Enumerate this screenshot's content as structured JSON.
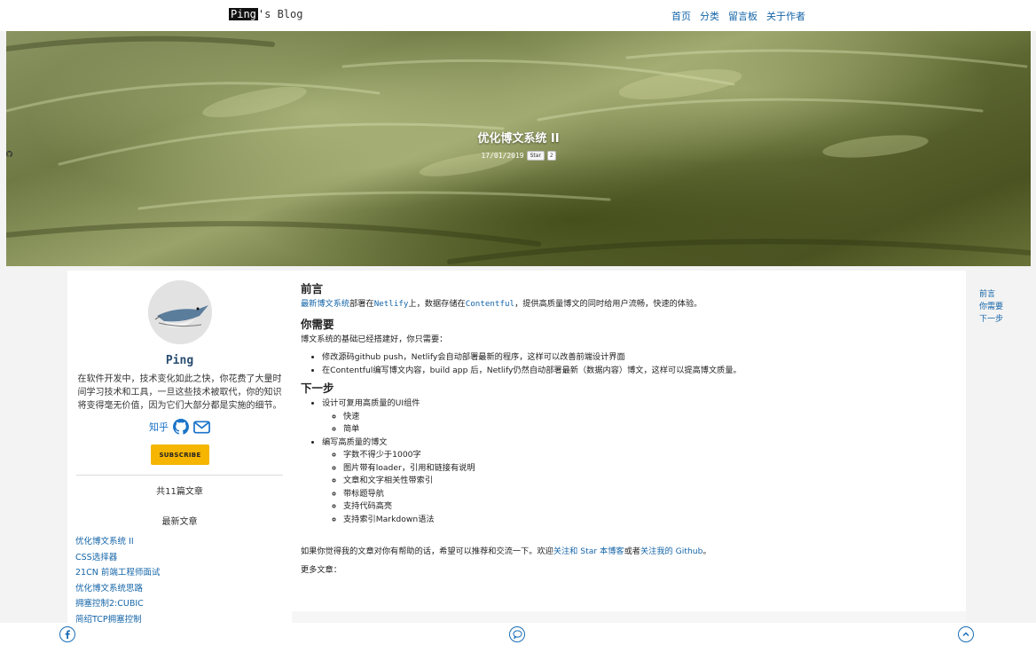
{
  "brand": {
    "highlight": "Ping",
    "rest": "'s Blog"
  },
  "nav": [
    "首页",
    "分类",
    "留言板",
    "关于作者"
  ],
  "hero": {
    "title": "优化博文系统 II",
    "date": "17/01/2019",
    "github_button": "Star",
    "star_count": "2"
  },
  "sidebar": {
    "author": "Ping",
    "bio": "在软件开发中，技术变化如此之快，你花费了大量时间学习技术和工具，一旦这些技术被取代，你的知识将变得毫无价值，因为它们大部分都是实施的细节。",
    "zhihu": "知乎",
    "icons": [
      "github-icon",
      "mail-icon"
    ],
    "subscribe": "SUBSCRIBE",
    "count": "共11篇文章",
    "recent_heading": "最新文章",
    "recent": [
      "优化博文系统 II",
      "CSS选择器",
      "21CN 前端工程师面试",
      "优化博文系统思路",
      "拥塞控制2:CUBIC",
      "简绍TCP拥塞控制"
    ]
  },
  "article": {
    "h_preface": "前言",
    "preface": {
      "link1": "最新博文系统",
      "t1": "部署在",
      "netlify": "Netlify",
      "t2": "上，数据存储在",
      "contentful": "Contentful",
      "t3": "，提供高质量博文的同时给用户流畅，快速的体验。"
    },
    "h_need": "你需要",
    "need_intro": "博文系统的基础已经搭建好，你只需要：",
    "need_items": [
      "修改源码github push，Netlify会自动部署最新的程序，这样可以改善前端设计界面",
      "在Contentful编写博文内容，build app 后，Netlify仍然自动部署最新（数据内容）博文，这样可以提高博文质量。"
    ],
    "h_next": "下一步",
    "next": {
      "item1": "设计可复用高质量的UI组件",
      "item1_sub": [
        "快速",
        "简单"
      ],
      "item2": "编写高质量的博文",
      "item2_sub": [
        "字数不得少于1000字",
        "图片带有loader，引用和链接有说明",
        "文章和文字相关性带索引",
        "带标题导航",
        "支持代码高亮",
        "支持索引Markdown语法"
      ]
    },
    "closing": {
      "t1": "如果你觉得我的文章对你有帮助的话，希望可以推荐和交流一下。欢迎",
      "l1": "关注和 Star 本博客",
      "t2": "或者",
      "l2": "关注我的 Github",
      "t3": "。"
    },
    "more": "更多文章："
  },
  "toc": [
    "前言",
    "你需要",
    "下一步"
  ],
  "bottom_icons": [
    "facebook-icon",
    "comment-icon",
    "arrow-up-icon"
  ]
}
